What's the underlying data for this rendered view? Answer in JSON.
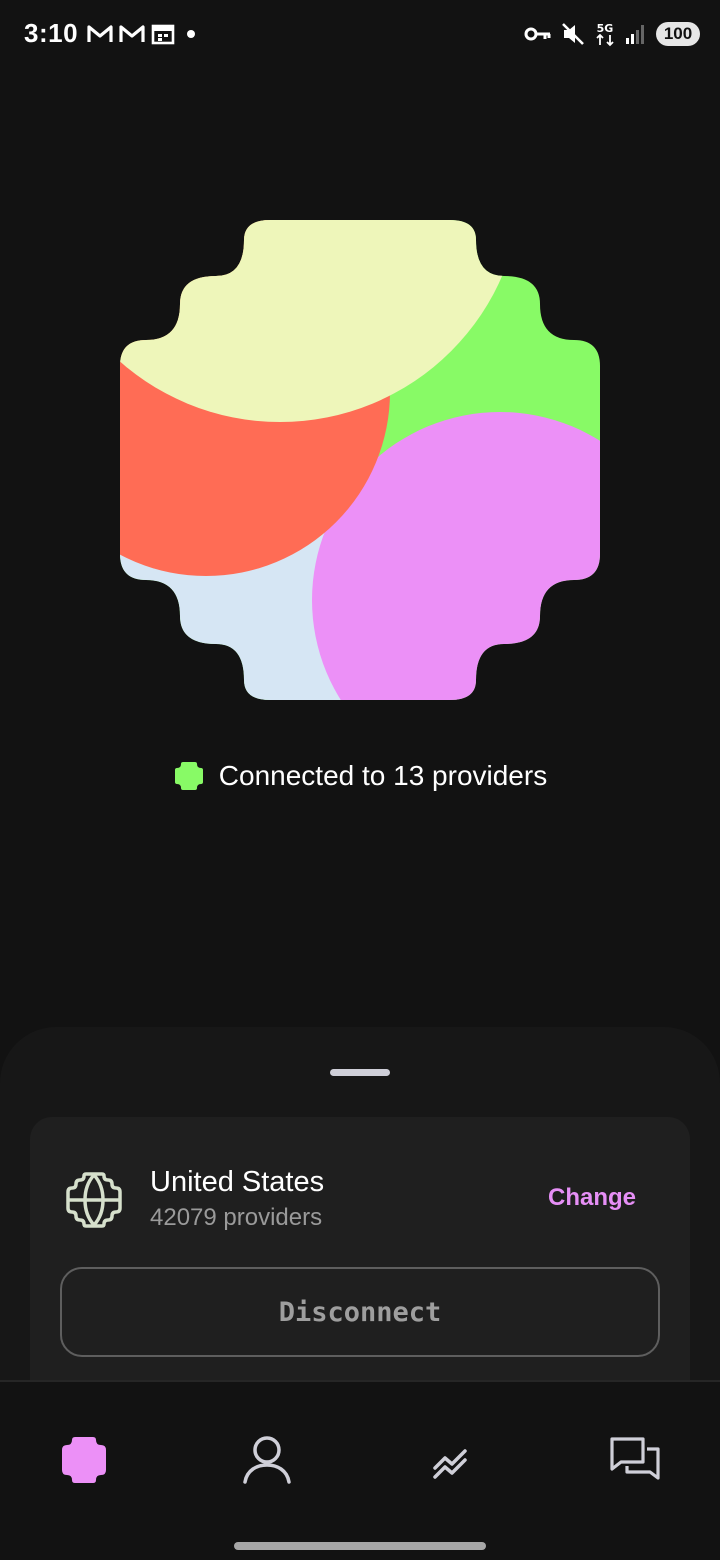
{
  "status_bar": {
    "time": "3:10",
    "left_icons": [
      "gmail-icon",
      "gmail-icon",
      "calendar-icon",
      "notification-dot-icon"
    ],
    "right_icons": [
      "vpn-key-icon",
      "mute-icon",
      "5g-icon",
      "signal-icon"
    ],
    "network_label": "5G",
    "battery": "100"
  },
  "hero": {
    "colors": {
      "yellow": "#EEF6BA",
      "green": "#88FA66",
      "pink": "#EC90F7",
      "blue": "#D6E6F4",
      "red": "#FF6C55"
    }
  },
  "connection": {
    "status_text": "Connected to 13 providers",
    "indicator_color": "#88FA66"
  },
  "location": {
    "icon": "globe-icon",
    "name": "United States",
    "providers": "42079 providers",
    "change_label": "Change"
  },
  "actions": {
    "disconnect_label": "Disconnect"
  },
  "nav": {
    "items": [
      "home-icon",
      "account-icon",
      "stats-icon",
      "chat-icon"
    ],
    "active": "home-icon",
    "accent": "#EC90F7"
  }
}
